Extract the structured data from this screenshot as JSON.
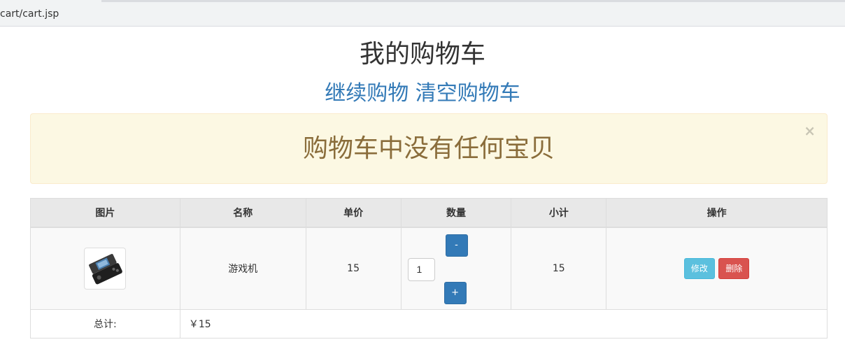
{
  "browser": {
    "url": "cart/cart.jsp"
  },
  "page": {
    "title": "我的购物车",
    "links": {
      "continue": "继续购物",
      "clear": "清空购物车"
    }
  },
  "alert": {
    "message": "购物车中没有任何宝贝",
    "close": "×"
  },
  "table": {
    "headers": [
      "图片",
      "名称",
      "单价",
      "数量",
      "小计",
      "操作"
    ],
    "rows": [
      {
        "image_icon": "game-console-icon",
        "name": "游戏机",
        "price": "15",
        "qty_minus": "-",
        "quantity": "1",
        "qty_plus": "+",
        "subtotal": "15",
        "edit": "修改",
        "delete": "删除"
      }
    ],
    "total_label": "总计:",
    "total_value": "￥15"
  },
  "colors": {
    "link": "#337ab7",
    "alert_bg": "#fcf8e3",
    "alert_text": "#8a6d3b",
    "primary_btn": "#337ab7",
    "info_btn": "#5bc0de",
    "danger_btn": "#d9534f"
  }
}
